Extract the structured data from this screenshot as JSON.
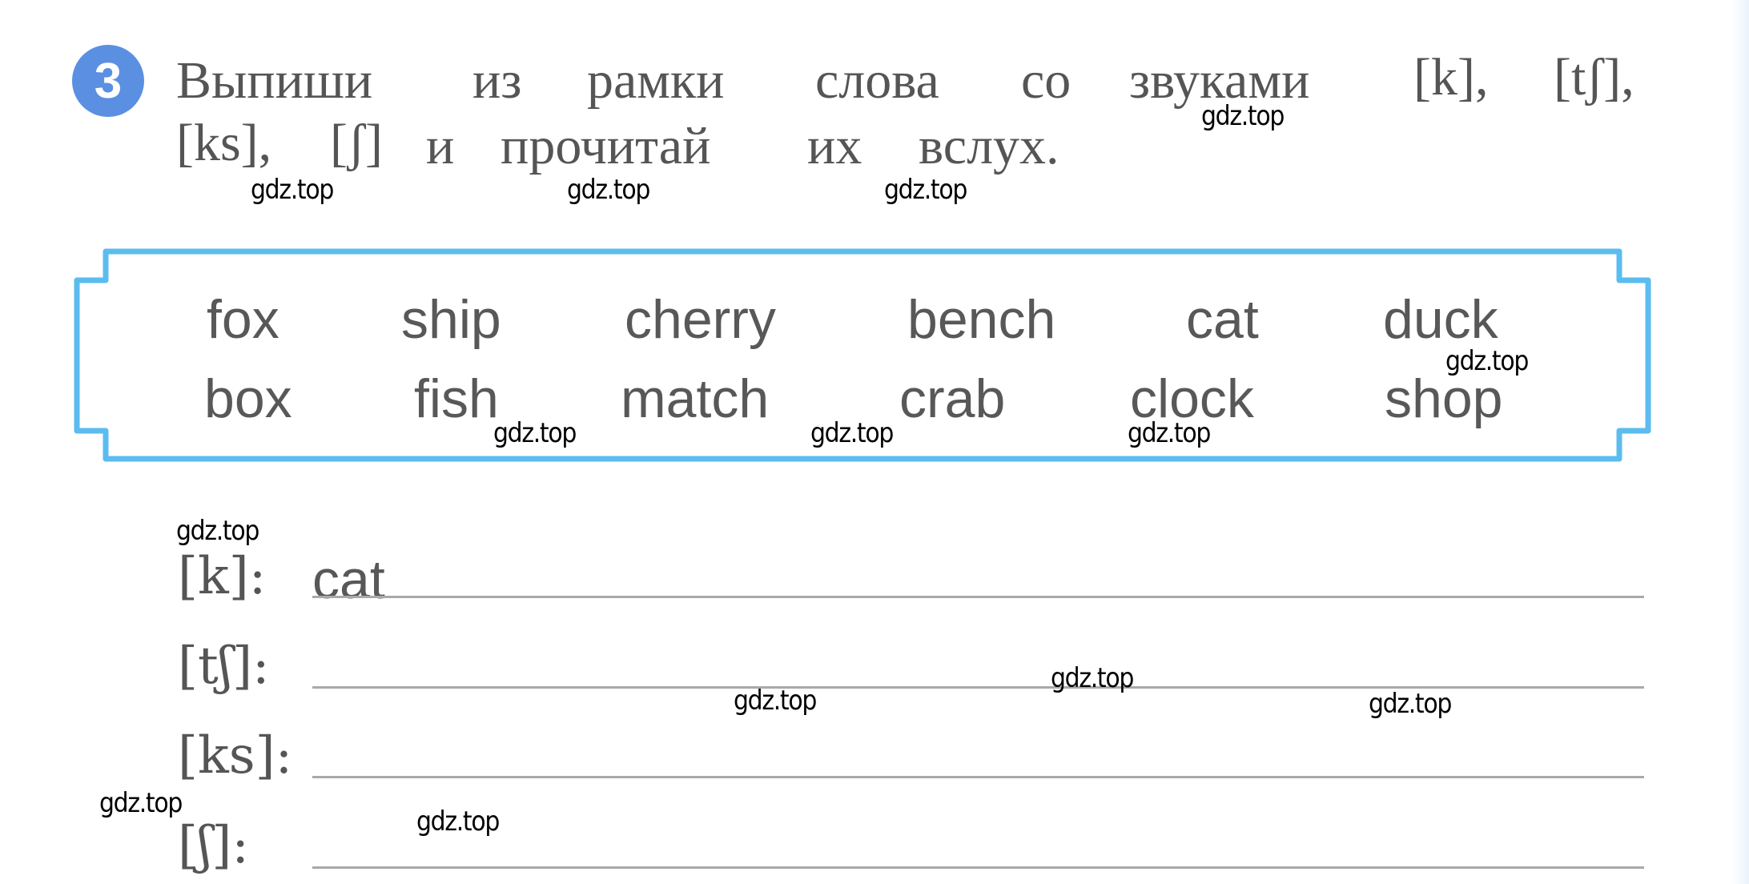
{
  "exercise": {
    "number": "3",
    "badge_color": "#5b8fe2",
    "instruction_line1_words": [
      "Выпиши",
      "из",
      "рамки",
      "слова",
      "со",
      "звуками",
      "[k],",
      "[tʃ],"
    ],
    "instruction_line2_words": [
      "[ks],",
      "[ʃ]",
      "и",
      "прочитай",
      "их",
      "вслух."
    ]
  },
  "word_box": {
    "border_color": "#5bbcf0",
    "rows": [
      [
        "fox",
        "ship",
        "cherry",
        "bench",
        "cat",
        "duck"
      ],
      [
        "box",
        "fish",
        "match",
        "crab",
        "clock",
        "shop"
      ]
    ]
  },
  "answers": [
    {
      "sound": "[k]:",
      "value": "cat"
    },
    {
      "sound": "[tʃ]:",
      "value": ""
    },
    {
      "sound": "[ks]:",
      "value": ""
    },
    {
      "sound": "[ʃ]:",
      "value": ""
    }
  ],
  "watermark": "gdz.top"
}
